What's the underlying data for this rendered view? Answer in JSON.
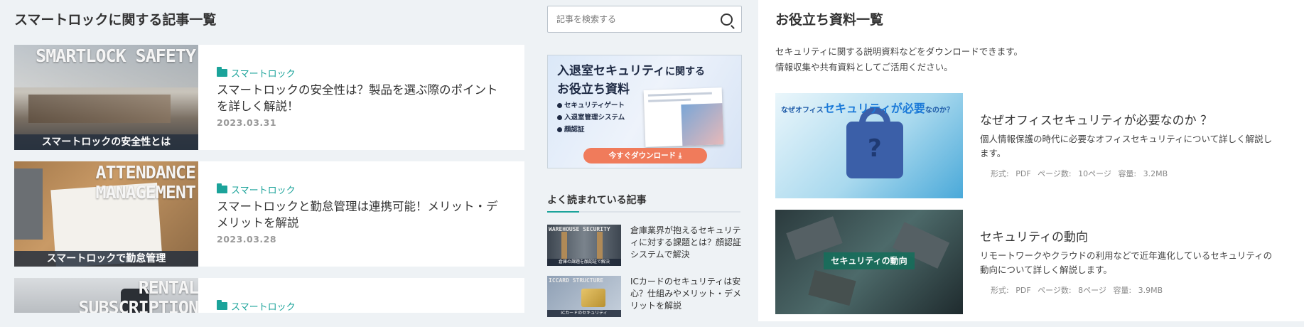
{
  "articles_section": {
    "heading": "スマートロックに関する記事一覧",
    "articles": [
      {
        "thumb_en": "SMARTLOCK SAFETY",
        "thumb_jp": "スマートロックの安全性とは",
        "category": "スマートロック",
        "title": "スマートロックの安全性は？製品を選ぶ際のポイントを詳しく解説！",
        "date": "2023.03.31"
      },
      {
        "thumb_en": "ATTENDANCE MANAGEMENT",
        "thumb_jp": "スマートロックで勤怠管理",
        "category": "スマートロック",
        "title": "スマートロックと勤怠管理は連携可能！メリット・デメリットを解説",
        "date": "2023.03.28"
      },
      {
        "thumb_en": "RENTAL SUBSCRIPTION",
        "category": "スマートロック"
      }
    ]
  },
  "sidebar": {
    "search_placeholder": "記事を検索する",
    "banner": {
      "title_line1": "入退室セキュリティ",
      "title_line1b": "に関する",
      "title_line2": "お役立ち資料",
      "items": [
        "セキュリティゲート",
        "入退室管理システム",
        "顔認証"
      ],
      "button": "今すぐダウンロード ⤓"
    },
    "popular_heading": "よく読まれている記事",
    "popular": [
      {
        "thumb_en": "WAREHOUSE SECURITY",
        "thumb_caption": "倉庫の課題を顔認証で解決",
        "title": "倉庫業界が抱えるセキュリティに対する課題とは？顔認証システムで解決"
      },
      {
        "thumb_en": "ICCARD STRUCTURE",
        "thumb_caption": "ICカードのセキュリティ",
        "title": "ICカードのセキュリティは安心？仕組みやメリット・デメリットを解説"
      }
    ]
  },
  "materials_section": {
    "heading": "お役立ち資料一覧",
    "desc_line1": "セキュリティに関する説明資料などをダウンロードできます。",
    "desc_line2": "情報収集や共有資料としてご活用ください。",
    "materials": [
      {
        "thumb_text_a": "なぜオフィス",
        "thumb_text_b": "セキュリティが必要",
        "thumb_text_c": "なのか？",
        "title": "なぜオフィスセキュリティが必要なのか ？",
        "desc": "個人情報保護の時代に必要なオフィスセキュリティについて詳しく解説します。",
        "meta_format_label": "形式:",
        "meta_format": "PDF",
        "meta_pages_label": "ページ数:",
        "meta_pages": "10ページ",
        "meta_size_label": "容量:",
        "meta_size": "3.2MB"
      },
      {
        "thumb_label": "セキュリティの動向",
        "title": "セキュリティの動向",
        "desc": "リモートワークやクラウドの利用などで近年進化しているセキュリティの動向について詳しく解説します。",
        "meta_format_label": "形式:",
        "meta_format": "PDF",
        "meta_pages_label": "ページ数:",
        "meta_pages": "8ページ",
        "meta_size_label": "容量:",
        "meta_size": "3.9MB"
      }
    ]
  }
}
